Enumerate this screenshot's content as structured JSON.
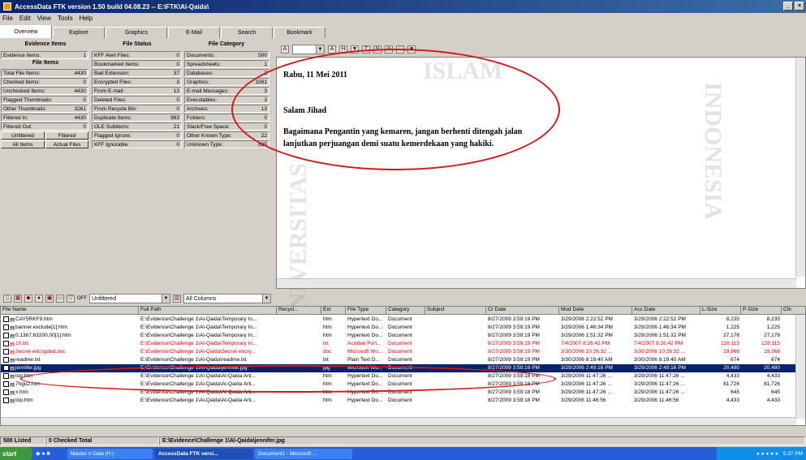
{
  "window": {
    "title": "AccessData FTK version 1.50 build 04.08.23 -- E:\\FTK\\Al-Qaida\\",
    "controls": [
      "_",
      "×"
    ]
  },
  "menu": [
    "File",
    "Edit",
    "View",
    "Tools",
    "Help"
  ],
  "tabs": [
    {
      "label": "Overview",
      "active": true
    },
    {
      "label": "Explore"
    },
    {
      "label": "Graphics"
    },
    {
      "label": "E-Mail"
    },
    {
      "label": "Search"
    },
    {
      "label": "Bookmark"
    }
  ],
  "overview": {
    "evidence_items_header": "Evidence Items",
    "file_status_header": "File Status",
    "file_category_header": "File Category",
    "file_items_header": "File Items",
    "evidence_items": {
      "label": "Evidence Items:",
      "value": "1"
    },
    "file_items": [
      {
        "label": "Total File Items:",
        "value": "4430"
      },
      {
        "label": "Checked Items:",
        "value": "0"
      },
      {
        "label": "Unchecked Items:",
        "value": "4430"
      },
      {
        "label": "Flagged Thumbnails:",
        "value": "0"
      },
      {
        "label": "Other Thumbnails:",
        "value": "3261"
      },
      {
        "label": "Filtered In:",
        "value": "4430"
      },
      {
        "label": "Filtered Out:",
        "value": "0"
      }
    ],
    "file_items_buttons": [
      "Unfiltered",
      "Filtered",
      "All Items",
      "Actual Files"
    ],
    "file_status": [
      {
        "label": "KFF Alert Files:",
        "value": "0"
      },
      {
        "label": "Bookmarked Items:",
        "value": "0"
      },
      {
        "label": "Bad Extension:",
        "value": "37"
      },
      {
        "label": "Encrypted Files:",
        "value": "3"
      },
      {
        "label": "From E-mail:",
        "value": "13"
      },
      {
        "label": "Deleted Files:",
        "value": "0"
      },
      {
        "label": "From Recycle Bin:",
        "value": "0"
      },
      {
        "label": "Duplicate Items:",
        "value": "963"
      },
      {
        "label": "OLE Subitems:",
        "value": "21"
      },
      {
        "label": "Flagged Ignore:",
        "value": "0"
      },
      {
        "label": "KFF Ignorable:",
        "value": "0"
      }
    ],
    "file_category": [
      {
        "label": "Documents:",
        "value": "500"
      },
      {
        "label": "Spreadsheets:",
        "value": "1"
      },
      {
        "label": "Databases:",
        "value": "2"
      },
      {
        "label": "Graphics:",
        "value": "3261"
      },
      {
        "label": "E-mail Messages:",
        "value": "3"
      },
      {
        "label": "Executables:",
        "value": "3"
      },
      {
        "label": "Archives:",
        "value": "13"
      },
      {
        "label": "Folders:",
        "value": "0"
      },
      {
        "label": "Slack/Free Space:",
        "value": "0"
      },
      {
        "label": "Other Known Type:",
        "value": "22"
      },
      {
        "label": "Unknown Type:",
        "value": "625"
      }
    ]
  },
  "viewer": {
    "line1": "Rabu, 11 Mei 2011",
    "line2": "Salam Jihad",
    "line3": "Bagaimana Pengantin yang kemaren, jangan berhenti ditengah jalan",
    "line4": "lanjutkan perjuangan demi suatu kemerdekaan yang hakiki."
  },
  "lower_toolbar": {
    "filter_toggle": "OFF",
    "filter_select": "Unfiltered",
    "columns_select": "All Columns"
  },
  "list": {
    "headers": [
      "File Name",
      "Full Path",
      "Recycl...",
      "Ext",
      "File Type",
      "Category",
      "Subject",
      "Cr Date",
      "Mod Date",
      "Acc Date",
      "L-Size",
      "P-Size",
      "Chi"
    ],
    "rows": [
      {
        "name": "CAY5RKF9.htm",
        "path": "E:\\Evidence\\Challenge 1\\Al-Qaida\\Temporary In...",
        "ext": "htm",
        "type": "Hypertext Do...",
        "cat": "Document",
        "cr": "8/27/2009 3:59:19 PM",
        "mod": "3/29/2006 2:22:52 PM",
        "acc": "3/29/2006 2:22:52 PM",
        "lsize": "8,235",
        "psize": "8,235",
        "style": ""
      },
      {
        "name": "banner.exclude[1].htm",
        "path": "E:\\Evidence\\Challenge 1\\Al-Qaida\\Temporary In...",
        "ext": "htm",
        "type": "Hypertext Do...",
        "cat": "Document",
        "cr": "8/27/2009 3:59:19 PM",
        "mod": "3/29/2006 1:46:34 PM",
        "acc": "3/29/2006 1:46:34 PM",
        "lsize": "1,225",
        "psize": "1,225",
        "style": ""
      },
      {
        "name": "0,1367,63200,00[1].htm",
        "path": "E:\\Evidence\\Challenge 1\\Al-Qaida\\Temporary In...",
        "ext": "htm",
        "type": "Hypertext Do...",
        "cat": "Document",
        "cr": "8/27/2009 3:59:19 PM",
        "mod": "3/29/2006 1:51:32 PM",
        "acc": "3/29/2006 1:51:32 PM",
        "lsize": "27,178",
        "psize": "27,178",
        "style": ""
      },
      {
        "name": "10.txt",
        "path": "E:\\Evidence\\Challenge 1\\Al-Qaida\\Temporary In...",
        "ext": "txt",
        "type": "Acrobat Port...",
        "cat": "Document",
        "cr": "8/27/2009 3:59:19 PM",
        "mod": "7/4/2007 8:26:42 PM",
        "acc": "7/4/2007 8:26:42 PM",
        "lsize": "128,115",
        "psize": "128,115",
        "style": "red"
      },
      {
        "name": "Secret-encrypted.doc",
        "path": "E:\\Evidence\\Challenge 1\\Al-Qaida\\Secret-encry...",
        "ext": "doc",
        "type": "Microsoft Wo...",
        "cat": "Document",
        "cr": "8/27/2009 3:59:19 PM",
        "mod": "3/30/2006 10:26:32 ...",
        "acc": "3/30/2006 10:26:32 ...",
        "lsize": "19,968",
        "psize": "19,968",
        "style": "red"
      },
      {
        "name": "readme.txt",
        "path": "E:\\Evidence\\Challenge 1\\Al-Qaida\\readme.txt",
        "ext": "txt",
        "type": "Plain Text D...",
        "cat": "Document",
        "cr": "8/27/2009 3:59:19 PM",
        "mod": "3/30/2006 8:19:40 AM",
        "acc": "3/30/2006 8:19:40 AM",
        "lsize": "674",
        "psize": "674",
        "style": ""
      },
      {
        "name": "jennifer.jpg",
        "path": "E:\\Evidence\\Challenge 1\\Al-Qaida\\jennifer.jpg",
        "ext": "jpg",
        "type": "Microsoft Wo...",
        "cat": "Document",
        "cr": "8/27/2009 3:59:19 PM",
        "mod": "3/29/2006 2:49:16 PM",
        "acc": "3/29/2006 2:49:16 PM",
        "lsize": "20,480",
        "psize": "20,480",
        "style": "selected"
      },
      {
        "name": "top.htm",
        "path": "E:\\Evidence\\Challenge 1\\Al-Qaida\\Al-Qaida Arti...",
        "ext": "htm",
        "type": "Hypertext Do...",
        "cat": "Document",
        "cr": "8/27/2009 3:59:18 PM",
        "mod": "3/29/2006 11:47:26 ...",
        "acc": "3/29/2006 11:47:26 ...",
        "lsize": "4,433",
        "psize": "4,433",
        "style": ""
      },
      {
        "name": "7hgu2.htm",
        "path": "E:\\Evidence\\Challenge 1\\Al-Qaida\\Al-Qaida Arti...",
        "ext": "htm",
        "type": "Hypertext Do...",
        "cat": "Document",
        "cr": "8/27/2009 3:59:18 PM",
        "mod": "3/29/2006 11:47:26 ...",
        "acc": "3/29/2006 11:47:26 ...",
        "lsize": "81,726",
        "psize": "81,726",
        "style": ""
      },
      {
        "name": "x.htm",
        "path": "E:\\Evidence\\Challenge 1\\Al-Qaida\\Al-Qaida Arti...",
        "ext": "htm",
        "type": "Hypertext Do...",
        "cat": "Document",
        "cr": "8/27/2009 3:59:18 PM",
        "mod": "3/29/2006 11:47:26 ...",
        "acc": "3/29/2006 11:47:26 ...",
        "lsize": "645",
        "psize": "645",
        "style": ""
      },
      {
        "name": "top.htm",
        "path": "E:\\Evidence\\Challenge 1\\Al-Qaida\\Al-Qaida Arti...",
        "ext": "htm",
        "type": "Hypertext Do...",
        "cat": "Document",
        "cr": "8/27/2009 3:59:18 PM",
        "mod": "3/29/2006 11:46:56",
        "acc": "3/29/2006 11:46:56",
        "lsize": "4,433",
        "psize": "4,433",
        "style": ""
      }
    ]
  },
  "status": {
    "listed": "500 Listed",
    "checked": "0 Checked Total",
    "path": "E:\\Evidence\\Challenge 1\\Al-Qaida\\jennifer.jpg"
  },
  "taskbar": {
    "start": "start",
    "items": [
      {
        "label": "Master n Data (H:)"
      },
      {
        "label": "AccessData FTK versi...",
        "active": true
      },
      {
        "label": "Document1 - Microsoft ..."
      }
    ],
    "clock": "5:37 PM"
  },
  "watermark": {
    "text1": "ISLAM",
    "text2": "INDONESIA",
    "text3": "UNIVERSITAS"
  },
  "colors": {
    "title_gradient_start": "#0a246a",
    "selected_row": "#0a246a",
    "alert_red": "#e00000",
    "annotation_red": "#d01818"
  }
}
